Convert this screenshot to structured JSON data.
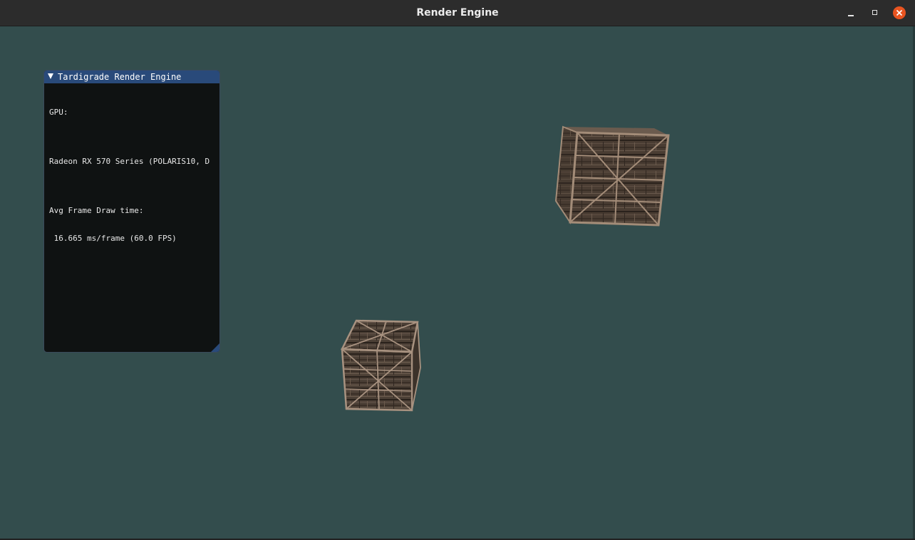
{
  "window": {
    "title": "Render Engine",
    "buttons": {
      "minimize_icon": "minimize-icon",
      "maximize_icon": "maximize-icon",
      "close_icon": "close-icon"
    },
    "accent_close": "#e95420"
  },
  "viewport": {
    "clear_color": "#334d4d",
    "objects": [
      "wooden-crate",
      "wooden-crate"
    ]
  },
  "panel": {
    "title": "Tardigrade Render Engine",
    "title_bar_color": "#294a7a",
    "gpu_label": "GPU:",
    "gpu_name": "Radeon RX 570 Series (POLARIS10, D",
    "frame_label": "Avg Frame Draw time:",
    "frame_value": " 16.665 ms/frame (60.0 FPS)"
  }
}
